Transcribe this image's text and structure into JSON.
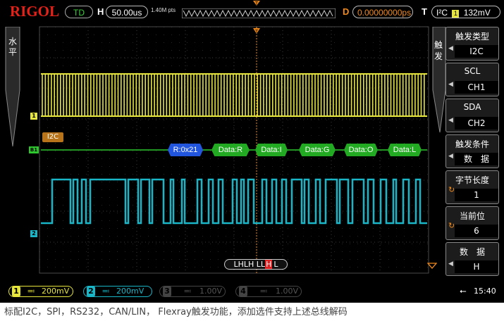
{
  "topbar": {
    "brand": "RIGOL",
    "status": "TD",
    "h_label": "H",
    "timebase": "50.00us",
    "sample_rate": "1.40M pts",
    "d_label": "D",
    "delay": "0.00000000ps",
    "t_label": "T",
    "trigger_type": "I²C",
    "trigger_ch": "1",
    "trigger_level": "132mV"
  },
  "left_sidebar": {
    "line1": "水",
    "line2": "平"
  },
  "menu": {
    "title_1": "触",
    "title_2": "发",
    "items": [
      {
        "title": "触发类型",
        "value": "I2C"
      },
      {
        "title": "SCL",
        "value": "CH1"
      },
      {
        "title": "SDA",
        "value": "CH2"
      },
      {
        "title": "触发条件",
        "value": "数　据"
      },
      {
        "title": "字节长度",
        "value": "1"
      },
      {
        "title": "当前位",
        "value": "6"
      },
      {
        "title": "数　据",
        "value": "H"
      }
    ]
  },
  "waveform": {
    "ch1_marker": "1",
    "ch2_marker": "2",
    "bus_marker": "B1",
    "bus_label": "I2C",
    "decode": [
      "R:0x21",
      "Data:R",
      "Data:I",
      "Data:G",
      "Data:O",
      "Data:L"
    ],
    "bit_pattern": "LHLH LL",
    "bit_current": "H",
    "bit_tail": "L",
    "trigger_marker": "T",
    "colors": {
      "ch1": "#e6e63c",
      "ch2": "#19b6c8",
      "bus": "#2ec82e",
      "decode_addr": "#2255dd",
      "decode_data": "#22aa22"
    }
  },
  "bottom": {
    "channels": [
      {
        "num": "1",
        "scale": "200mV",
        "active": true
      },
      {
        "num": "2",
        "scale": "200mV",
        "active": true
      },
      {
        "num": "3",
        "scale": "1.00V",
        "active": false
      },
      {
        "num": "4",
        "scale": "1.00V",
        "active": false
      }
    ],
    "time": "15:40"
  },
  "caption": "标配I2C，SPI，RS232，CAN/LIN， Flexray触发功能，添加选件支持上述总线解码"
}
